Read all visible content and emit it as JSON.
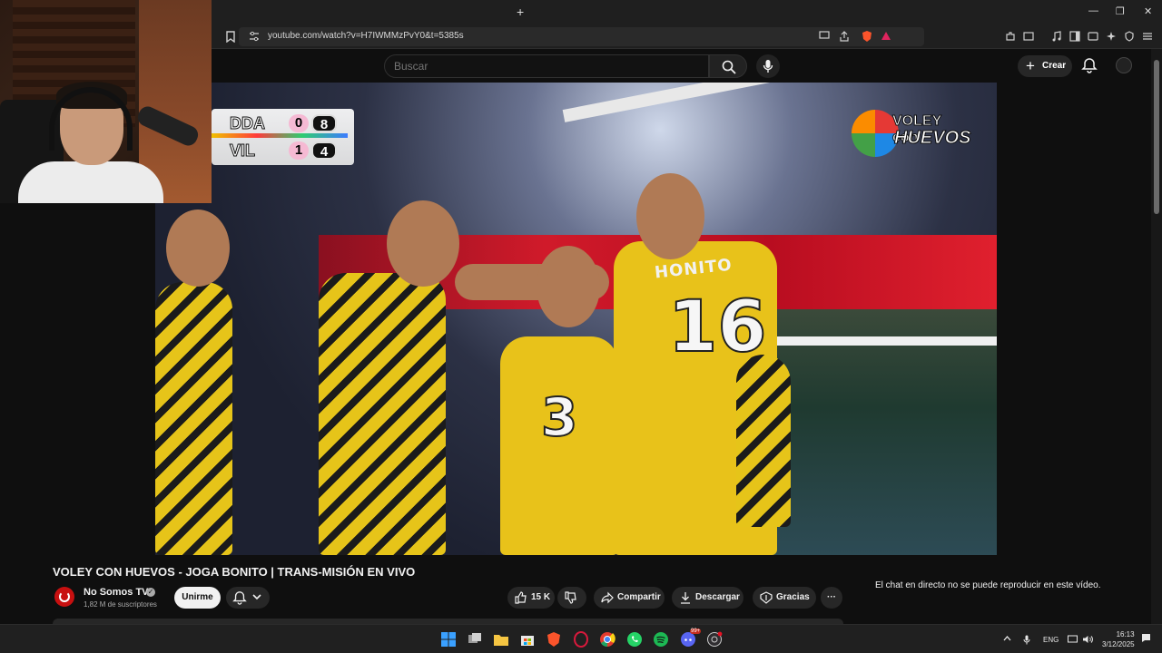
{
  "browser": {
    "url": "youtube.com/watch?v=H7IWMMzPvY0&t=5385s",
    "new_tab_label": "+",
    "window_controls": [
      "—",
      "❐",
      "✕"
    ]
  },
  "youtube": {
    "search_placeholder": "Buscar",
    "create_label": "Crear"
  },
  "video": {
    "scoreboard": {
      "rows": [
        {
          "team": "DDA",
          "sets": "0",
          "points": "8"
        },
        {
          "team": "VIL",
          "sets": "1",
          "points": "4"
        }
      ]
    },
    "brand_top": "VOLEY con",
    "brand_bottom": "HUEVOS",
    "jersey_name": "HONITO",
    "jersey_number_main": "16",
    "jersey_number_2": "3"
  },
  "meta": {
    "title": "VOLEY CON HUEVOS - JOGA BONITO | TRANS-MISIÓN EN VIVO",
    "channel_name": "No Somos TV",
    "subscribers": "1,82 M de suscriptores",
    "join_label": "Unirme",
    "likes": "15 K",
    "share_label": "Compartir",
    "download_label": "Descargar",
    "thanks_label": "Gracias",
    "more_label": "···"
  },
  "chat": {
    "notice": "El chat en directo no se puede reproducir en este vídeo."
  },
  "taskbar": {
    "lang": "ENG",
    "time": "16:13",
    "date": "3/12/2025",
    "badge": "99+"
  }
}
